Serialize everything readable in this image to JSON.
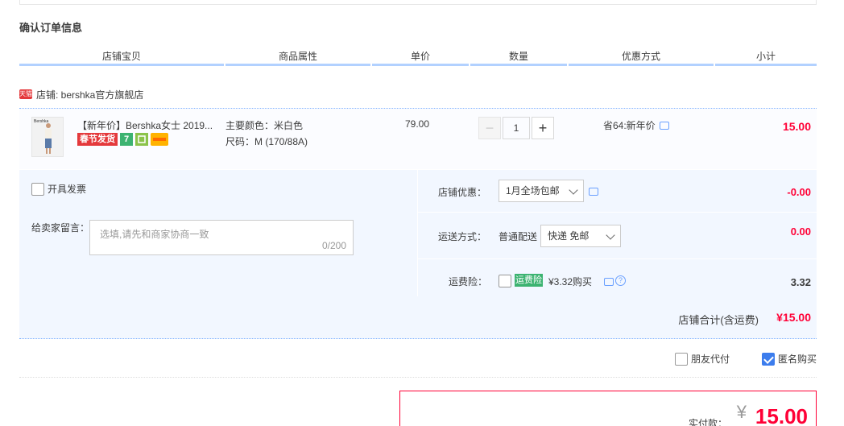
{
  "section_title": "确认订单信息",
  "columns": [
    "店铺宝贝",
    "商品属性",
    "单价",
    "数量",
    "优惠方式",
    "小计"
  ],
  "shop": {
    "badge": "天猫",
    "label": "店铺: bershka官方旗舰店"
  },
  "item": {
    "title": "【新年价】Bershka女士 2019...",
    "thumb_brand": "Bershka",
    "tags": {
      "spring": "春节发货",
      "seven": "7"
    },
    "attr_color": "主要颜色：米白色",
    "attr_size": "尺码：M (170/88A)",
    "price": "79.00",
    "qty_minus": "−",
    "qty": "1",
    "qty_plus": "+",
    "discount": "省64:新年价",
    "subtotal": "15.00"
  },
  "invoice_label": "开具发票",
  "message": {
    "label": "给卖家留言：",
    "placeholder": "选填,请先和商家协商一致",
    "count": "0/200"
  },
  "shop_discount": {
    "label": "店铺优惠：",
    "selected": "1月全场包邮",
    "value": "-0.00"
  },
  "shipping": {
    "label": "运送方式：",
    "method": "普通配送",
    "selected": "快递 免邮",
    "value": "0.00"
  },
  "insurance": {
    "label": "运费险：",
    "tag": "运费险",
    "price_text": "¥3.32购买",
    "value": "3.32"
  },
  "shop_total": {
    "label": "店铺合计(含运费)",
    "value": "¥15.00"
  },
  "options": {
    "friend_pay": "朋友代付",
    "anonymous": "匿名购买"
  },
  "pay": {
    "label": "实付款：",
    "currency": "¥",
    "amount": "15.00"
  },
  "colors": {
    "accent_red": "#ff0036",
    "accent_blue": "#b2d1ff",
    "panel_bg": "#f2f7ff"
  }
}
